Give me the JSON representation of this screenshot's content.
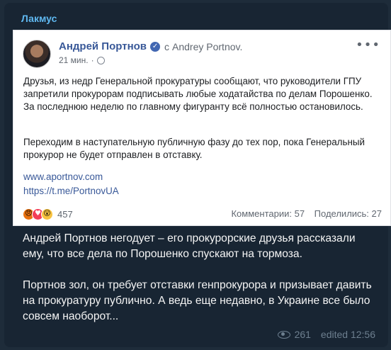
{
  "channel": {
    "name": "Лакмус"
  },
  "embedded_post": {
    "author": "Андрей Портнов",
    "with_prefix": "с",
    "with_name": "Andrey Portnov.",
    "time": "21 мин.",
    "paragraph1": "Друзья, из недр Генеральной прокуратуры сообщают, что руководители ГПУ запретили прокурорам подписывать любые ходатайства по делам Порошенко. За последнюю неделю по главному фигуранту всё полностью остановилось.",
    "paragraph2": "Переходим в наступательную публичную фазу до тех пор, пока Генеральный прокурор не будет отправлен в отставку.",
    "link1": "www.aportnov.com",
    "link2": "https://t.me/PortnovUA",
    "reactions_count": "457",
    "comments": "Комментарии: 57",
    "shares": "Поделились: 27"
  },
  "message": {
    "paragraph1": "Андрей Портнов негодует – его прокурорские друзья рассказали ему, что все дела по Порошенко спускают на тормоза.",
    "paragraph2": "Портнов зол, он требует отставки генпрокурора и призывает давить на прокуратуру публично. А ведь еще недавно, в Украине все было совсем наоборот..."
  },
  "footer": {
    "views": "261",
    "edited": "edited 12:56"
  },
  "icons": [
    "verified-icon",
    "globe-icon",
    "more-icon",
    "angry-reaction-icon",
    "love-reaction-icon",
    "wow-reaction-icon",
    "eye-icon"
  ],
  "colors": {
    "background": "#1e2c3a",
    "channel_name": "#5fb8f0",
    "fb_link": "#385898"
  }
}
